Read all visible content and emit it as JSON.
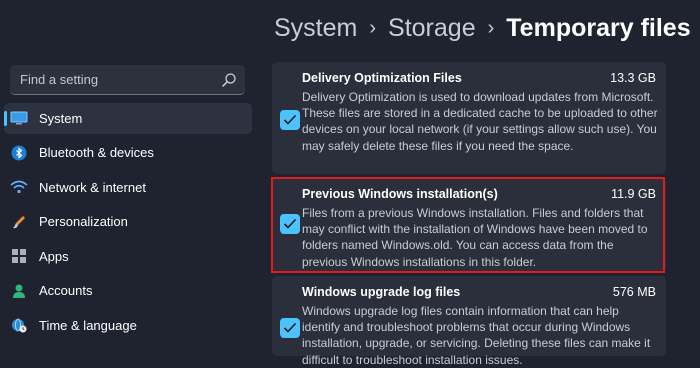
{
  "breadcrumb": [
    "System",
    "Storage",
    "Temporary files"
  ],
  "search": {
    "placeholder": "Find a setting"
  },
  "nav": {
    "items": [
      {
        "label": "System",
        "icon": "monitor-icon"
      },
      {
        "label": "Bluetooth & devices",
        "icon": "bluetooth-icon"
      },
      {
        "label": "Network & internet",
        "icon": "wifi-icon"
      },
      {
        "label": "Personalization",
        "icon": "brush-icon"
      },
      {
        "label": "Apps",
        "icon": "apps-icon"
      },
      {
        "label": "Accounts",
        "icon": "person-icon"
      },
      {
        "label": "Time & language",
        "icon": "globe-clock-icon"
      }
    ],
    "active_index": 0
  },
  "files": [
    {
      "title": "Delivery Optimization Files",
      "size": "13.3 GB",
      "checked": true,
      "description": "Delivery Optimization is used to download updates from Microsoft. These files are stored in a dedicated cache to be uploaded to other devices on your local network (if your settings allow such use). You may safely delete these files if you need the space."
    },
    {
      "title": "Previous Windows installation(s)",
      "size": "11.9 GB",
      "checked": true,
      "description": "Files from a previous Windows installation.  Files and folders that may conflict with the installation of Windows have been moved to folders named Windows.old.  You can access data from the previous Windows installations in this folder."
    },
    {
      "title": "Windows upgrade log files",
      "size": "576 MB",
      "checked": true,
      "description": "Windows upgrade log files contain information that can help identify and troubleshoot problems that occur during Windows installation, upgrade, or servicing.  Deleting these files can make it difficult to troubleshoot installation issues."
    }
  ],
  "colors": {
    "accent": "#4cc2ff",
    "highlight": "#e01c1c",
    "background": "#1f2330",
    "card": "#2b2f3b"
  }
}
